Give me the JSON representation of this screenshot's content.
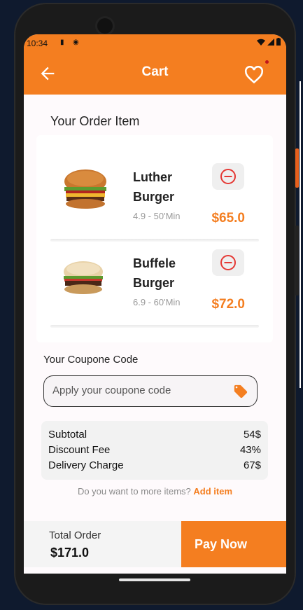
{
  "status": {
    "time": "10:34"
  },
  "appbar": {
    "title": "Cart"
  },
  "order": {
    "title": "Your Order Item",
    "items": [
      {
        "name_line1": "Luther",
        "name_line2": "Burger",
        "meta": "4.9 - 50'Min",
        "price": "$65.0"
      },
      {
        "name_line1": "Buffele",
        "name_line2": "Burger",
        "meta": "6.9 - 60'Min",
        "price": "$72.0"
      }
    ]
  },
  "coupon": {
    "title": "Your Coupone Code",
    "placeholder": "Apply your coupone code"
  },
  "summary": [
    {
      "label": "Subtotal",
      "value": "54$"
    },
    {
      "label": "Discount Fee",
      "value": "43%"
    },
    {
      "label": "Delivery Charge",
      "value": "67$"
    }
  ],
  "more": {
    "text": "Do you want to more items?",
    "link": "Add item"
  },
  "footer": {
    "total_label": "Total Order",
    "total_value": "$171.0",
    "pay_label": "Pay Now"
  },
  "colors": {
    "accent": "#f47e20",
    "remove": "#e53935"
  },
  "icons": [
    "back-arrow-icon",
    "heart-icon",
    "minus-circle-icon",
    "tag-icon",
    "sim-icon",
    "signal-icon",
    "wifi-icon",
    "battery-icon"
  ]
}
